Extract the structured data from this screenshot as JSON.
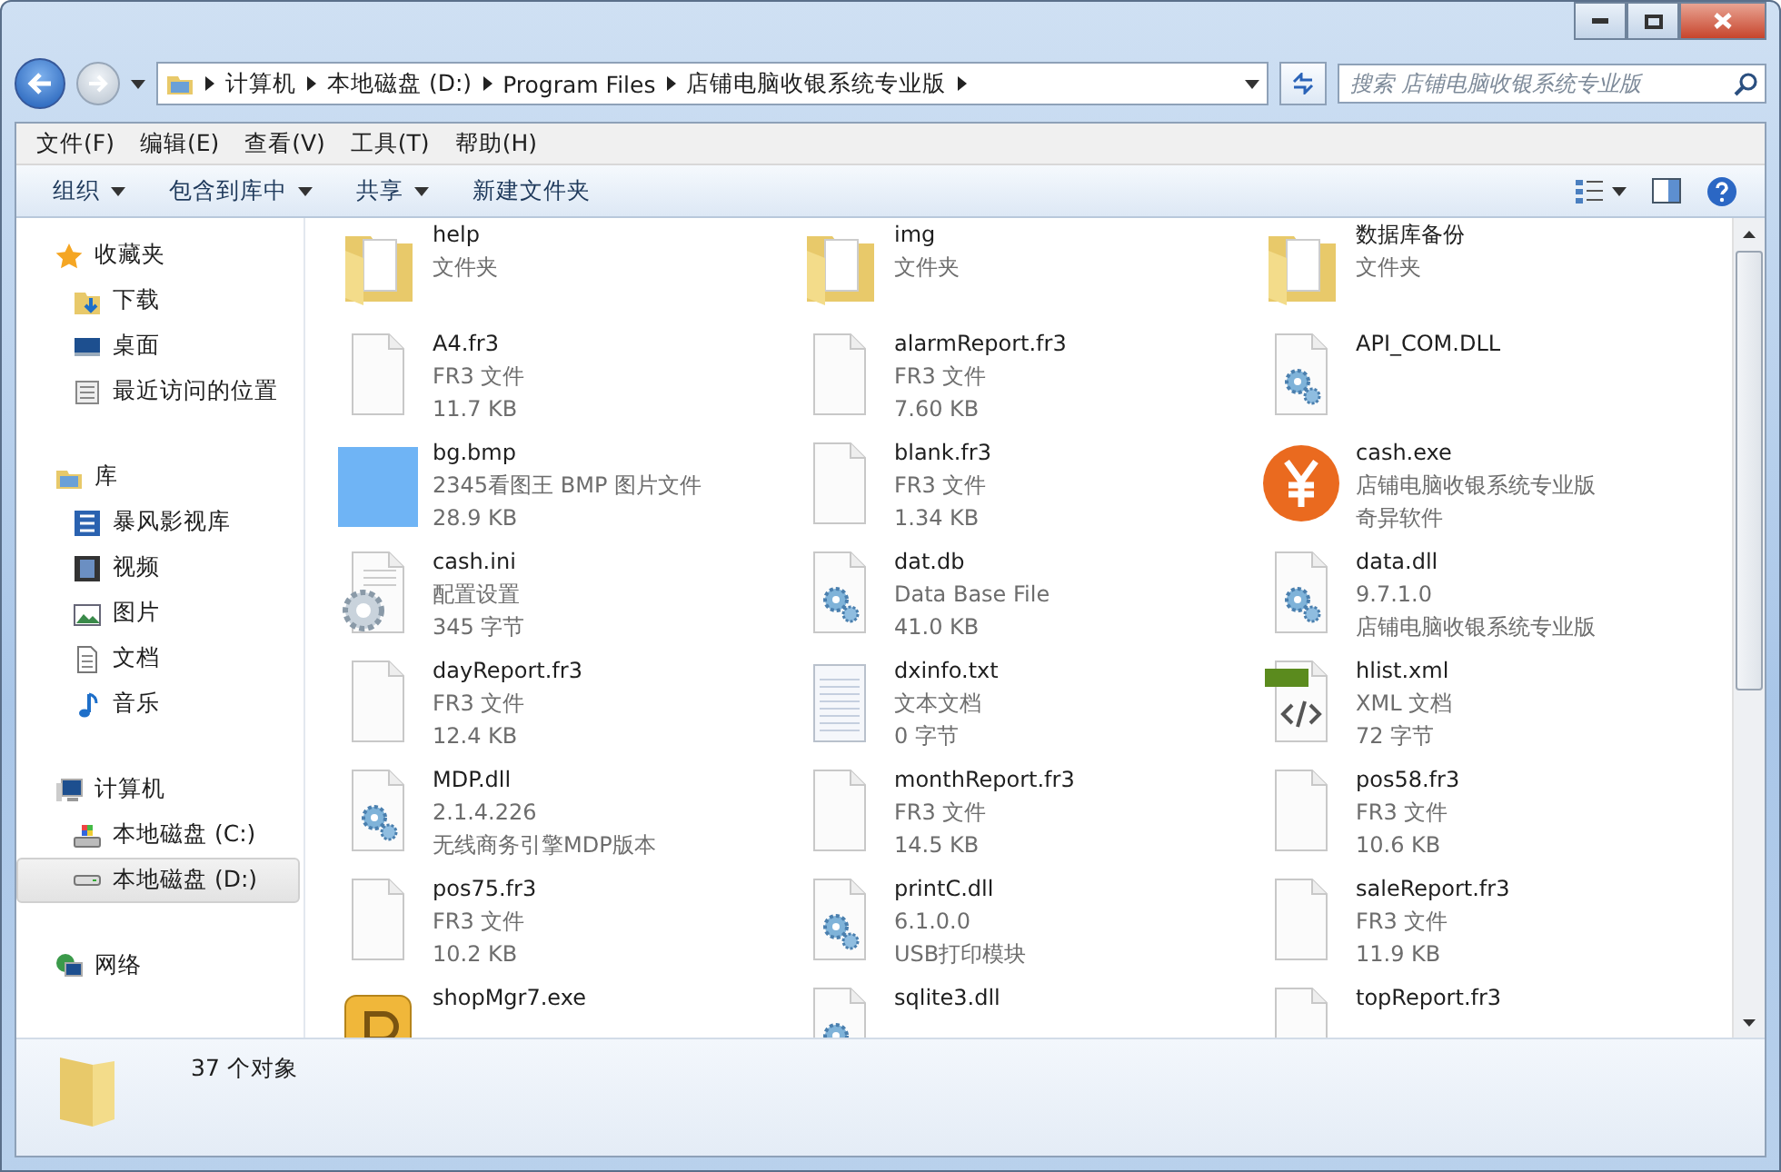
{
  "address": {
    "crumbs": [
      "计算机",
      "本地磁盘 (D:)",
      "Program Files",
      "店铺电脑收银系统专业版"
    ]
  },
  "search": {
    "placeholder": "搜索 店铺电脑收银系统专业版"
  },
  "menu": [
    "文件(F)",
    "编辑(E)",
    "查看(V)",
    "工具(T)",
    "帮助(H)"
  ],
  "toolbar": [
    {
      "label": "组织",
      "dropdown": true
    },
    {
      "label": "包含到库中",
      "dropdown": true
    },
    {
      "label": "共享",
      "dropdown": true
    },
    {
      "label": "新建文件夹",
      "dropdown": false
    }
  ],
  "sidebar": [
    {
      "label": "收藏夹",
      "kind": "star",
      "selected": false,
      "children": [
        {
          "label": "下载",
          "kind": "download",
          "selected": false
        },
        {
          "label": "桌面",
          "kind": "desktop",
          "selected": false
        },
        {
          "label": "最近访问的位置",
          "kind": "recent",
          "selected": false
        }
      ]
    },
    {
      "label": "库",
      "kind": "library",
      "selected": false,
      "children": [
        {
          "label": "暴风影视库",
          "kind": "media",
          "selected": false
        },
        {
          "label": "视频",
          "kind": "video",
          "selected": false
        },
        {
          "label": "图片",
          "kind": "picture",
          "selected": false
        },
        {
          "label": "文档",
          "kind": "document",
          "selected": false
        },
        {
          "label": "音乐",
          "kind": "music",
          "selected": false
        }
      ]
    },
    {
      "label": "计算机",
      "kind": "computer",
      "selected": false,
      "children": [
        {
          "label": "本地磁盘 (C:)",
          "kind": "sysdrive",
          "selected": false
        },
        {
          "label": "本地磁盘 (D:)",
          "kind": "drive",
          "selected": true
        }
      ]
    },
    {
      "label": "网络",
      "kind": "network",
      "selected": false
    }
  ],
  "files": [
    {
      "name": "help",
      "kind": "folder",
      "details": [
        "文件夹"
      ]
    },
    {
      "name": "img",
      "kind": "folder",
      "details": [
        "文件夹"
      ]
    },
    {
      "name": "数据库备份",
      "kind": "folder",
      "details": [
        "文件夹"
      ]
    },
    {
      "name": "A4.fr3",
      "kind": "blank",
      "details": [
        "FR3 文件",
        "11.7 KB"
      ]
    },
    {
      "name": "alarmReport.fr3",
      "kind": "blank",
      "details": [
        "FR3 文件",
        "7.60 KB"
      ]
    },
    {
      "name": "API_COM.DLL",
      "kind": "gear"
    },
    {
      "name": "bg.bmp",
      "kind": "image",
      "details": [
        "2345看图王 BMP 图片文件",
        "28.9 KB"
      ]
    },
    {
      "name": "blank.fr3",
      "kind": "blank",
      "details": [
        "FR3 文件",
        "1.34 KB"
      ]
    },
    {
      "name": "cash.exe",
      "kind": "yen",
      "details": [
        "店铺电脑收银系统专业版",
        "奇异软件"
      ]
    },
    {
      "name": "cash.ini",
      "kind": "settings",
      "details": [
        "配置设置",
        "345 字节"
      ]
    },
    {
      "name": "dat.db",
      "kind": "gear",
      "details": [
        "Data Base File",
        "41.0 KB"
      ]
    },
    {
      "name": "data.dll",
      "kind": "gear",
      "details": [
        "9.7.1.0",
        "店铺电脑收银系统专业版"
      ]
    },
    {
      "name": "dayReport.fr3",
      "kind": "blank",
      "details": [
        "FR3 文件",
        "12.4 KB"
      ]
    },
    {
      "name": "dxinfo.txt",
      "kind": "text",
      "details": [
        "文本文档",
        "0 字节"
      ]
    },
    {
      "name": "hlist.xml",
      "kind": "xml",
      "details": [
        "XML 文档",
        "72 字节"
      ]
    },
    {
      "name": "MDP.dll",
      "kind": "gear",
      "details": [
        "2.1.4.226",
        "无线商务引擎MDP版本"
      ]
    },
    {
      "name": "monthReport.fr3",
      "kind": "blank",
      "details": [
        "FR3 文件",
        "14.5 KB"
      ]
    },
    {
      "name": "pos58.fr3",
      "kind": "blank",
      "details": [
        "FR3 文件",
        "10.6 KB"
      ]
    },
    {
      "name": "pos75.fr3",
      "kind": "blank",
      "details": [
        "FR3 文件",
        "10.2 KB"
      ]
    },
    {
      "name": "printC.dll",
      "kind": "gear",
      "details": [
        "6.1.0.0",
        "USB打印模块"
      ]
    },
    {
      "name": "saleReport.fr3",
      "kind": "blank",
      "details": [
        "FR3 文件",
        "11.9 KB"
      ]
    },
    {
      "name": "shopMgr7.exe",
      "kind": "app"
    },
    {
      "name": "sqlite3.dll",
      "kind": "gear"
    },
    {
      "name": "topReport.fr3",
      "kind": "blank"
    }
  ],
  "status_bar": {
    "text": "37 个对象"
  }
}
